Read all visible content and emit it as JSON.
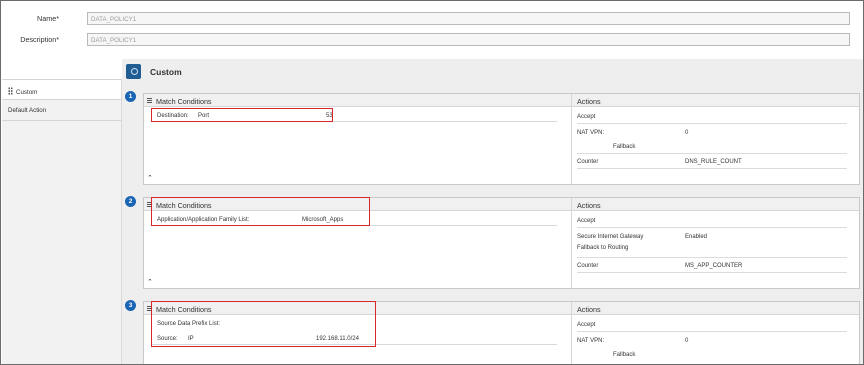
{
  "form": {
    "name_label": "Name*",
    "name_value": "DATA_POLICY1",
    "description_label": "Description*",
    "description_value": "DATA_POLICY1"
  },
  "sidebar": {
    "items": [
      {
        "label": "Custom",
        "active": true
      },
      {
        "label": "Default Action",
        "active": false
      }
    ]
  },
  "main": {
    "title": "Custom",
    "sequences": [
      {
        "number": "1",
        "match_title": "Match Conditions",
        "actions_title": "Actions",
        "conditions": [
          {
            "label": "Destination:",
            "type": "Port",
            "value": "53"
          }
        ],
        "actions": {
          "accept": "Accept",
          "nat_label": "NAT VPN:",
          "nat_value": "0",
          "fallback": "Fallback",
          "counter_label": "Counter",
          "counter_value": "DNS_RULE_COUNT"
        }
      },
      {
        "number": "2",
        "match_title": "Match Conditions",
        "actions_title": "Actions",
        "conditions": [
          {
            "label": "Application/Application Family List:",
            "value": "Microsoft_Apps"
          }
        ],
        "actions": {
          "accept": "Accept",
          "sig_label_1": "Secure Internet Gateway",
          "sig_label_2": "Fallback to Routing",
          "sig_value": "Enabled",
          "counter_label": "Counter",
          "counter_value": "MS_APP_COUNTER"
        }
      },
      {
        "number": "3",
        "match_title": "Match Conditions",
        "actions_title": "Actions",
        "conditions": [
          {
            "label": "Source Data Prefix List:"
          },
          {
            "label": "Source:",
            "type": "IP",
            "value": "192.168.11.0/24"
          }
        ],
        "actions": {
          "accept": "Accept",
          "nat_label": "NAT VPN:",
          "nat_value": "0",
          "fallback": "Fallback"
        }
      }
    ]
  },
  "colors": {
    "highlight": "#d62828",
    "badge": "#1a64b4",
    "custom_icon": "#1f5d93"
  },
  "icons": {
    "grip": "drag-handle-icon",
    "menu": "hamburger-menu-icon",
    "collapse": "chevron-up-icon"
  }
}
